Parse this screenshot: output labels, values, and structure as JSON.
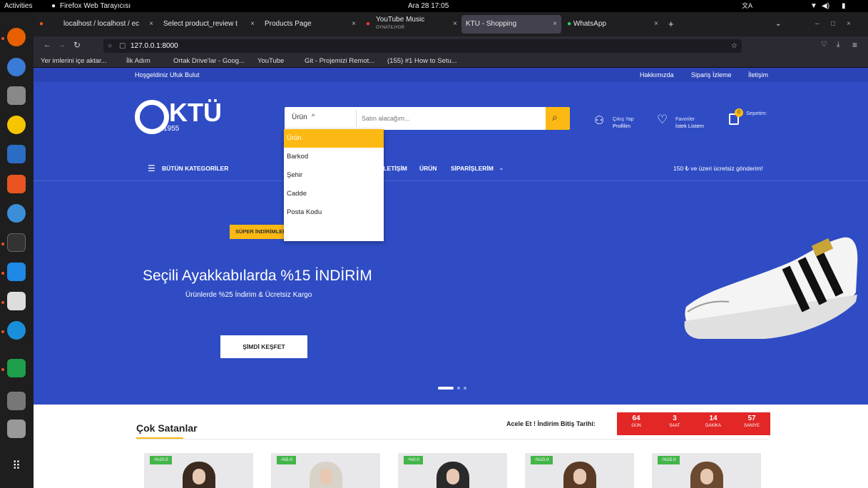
{
  "system": {
    "activities": "Activities",
    "app_name": "Firefox Web Tarayıcısı",
    "clock": "Ara 28 17:05"
  },
  "browser": {
    "tabs": [
      {
        "label": "localhost / localhost / ec"
      },
      {
        "label": "Select product_review t"
      },
      {
        "label": "Products Page"
      },
      {
        "label": "YouTube Music",
        "sub": "OYNATILIYOR"
      },
      {
        "label": "KTU - Shopping"
      },
      {
        "label": "WhatsApp"
      }
    ],
    "url": "127.0.0.1:8000",
    "bookmarks": [
      "Yer imlerini içe aktar...",
      "İlk Adım",
      "Ortak Drive'lar - Goog...",
      "YouTube",
      "Git - Projemizi Remot...",
      "(155) #1 How to Setu..."
    ]
  },
  "site": {
    "welcome": "Hoşgeldiniz Ufuk Bulut",
    "top_links": [
      "Hakkımızda",
      "Sipariş İzleme",
      "İletişim"
    ],
    "logo": {
      "name": "KTÜ",
      "year": "1955"
    },
    "search": {
      "category_selected": "Ürün",
      "placeholder": "Satın alacağım...",
      "options": [
        "Ürün",
        "Barkod",
        "Şehir",
        "Cadde",
        "Posta Kodu"
      ]
    },
    "account": {
      "line1": "Çıkış Yap",
      "line2": "Profilim"
    },
    "favorites": {
      "line1": "Favoriler",
      "line2": "İstek Listem"
    },
    "cart": {
      "count": "0",
      "label": "Sepetim:"
    },
    "nav": {
      "all_categories": "BÜTÜN KATEGORİLER",
      "items": [
        "İLETİŞİM",
        "ÜRÜN",
        "SİPARİŞLERİM"
      ],
      "shipping": "150 ₺ ve üzeri ücretsiz gönderim!"
    },
    "hero": {
      "badge": "SÜPER İNDİRİMLER",
      "title": "Seçili Ayakkabılarda %15 İNDİRİM",
      "subtitle": "Ürünlerde %25 İndirim & Ücretsiz Kargo",
      "cta": "ŞİMDİ KEŞFET",
      "active_slide": 1,
      "slide_count": 3
    },
    "bestsellers": {
      "title": "Çok Satanlar",
      "countdown_label": "Acele Et ! İndirim Bitiş Tarihi:",
      "countdown": [
        {
          "value": "64",
          "unit": "GÜN"
        },
        {
          "value": "3",
          "unit": "SAAT"
        },
        {
          "value": "14",
          "unit": "DAKİKA"
        },
        {
          "value": "57",
          "unit": "SANİYE"
        }
      ],
      "products": [
        {
          "discount": "-%10.0"
        },
        {
          "discount": "-%5.0"
        },
        {
          "discount": "-%0.0"
        },
        {
          "discount": "-%10.0"
        },
        {
          "discount": "-%15.0"
        }
      ]
    }
  }
}
